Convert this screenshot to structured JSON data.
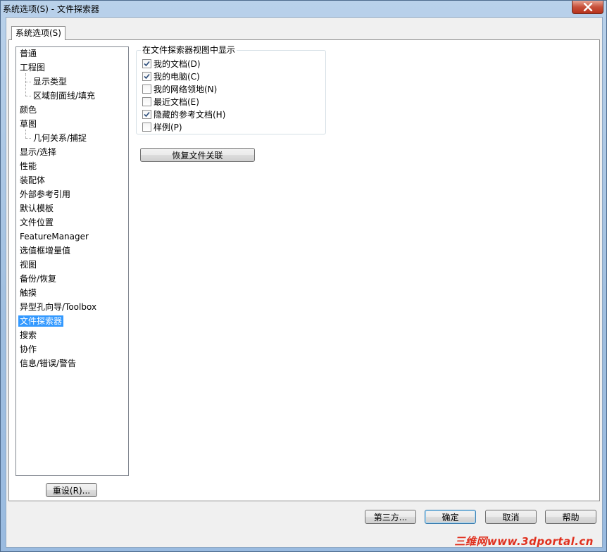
{
  "window": {
    "title": "系统选项(S) - 文件探索器"
  },
  "tab": {
    "label": "系统选项(S)"
  },
  "tree": {
    "items": [
      {
        "label": "普通",
        "level": 0
      },
      {
        "label": "工程图",
        "level": 0
      },
      {
        "label": "显示类型",
        "level": 1
      },
      {
        "label": "区域剖面线/填充",
        "level": 1
      },
      {
        "label": "颜色",
        "level": 0
      },
      {
        "label": "草图",
        "level": 0
      },
      {
        "label": "几何关系/捕捉",
        "level": 1
      },
      {
        "label": "显示/选择",
        "level": 0
      },
      {
        "label": "性能",
        "level": 0
      },
      {
        "label": "装配体",
        "level": 0
      },
      {
        "label": "外部参考引用",
        "level": 0
      },
      {
        "label": "默认模板",
        "level": 0
      },
      {
        "label": "文件位置",
        "level": 0
      },
      {
        "label": "FeatureManager",
        "level": 0
      },
      {
        "label": "选值框增量值",
        "level": 0
      },
      {
        "label": "视图",
        "level": 0
      },
      {
        "label": "备份/恢复",
        "level": 0
      },
      {
        "label": "触摸",
        "level": 0
      },
      {
        "label": "异型孔向导/Toolbox",
        "level": 0
      },
      {
        "label": "文件探索器",
        "level": 0,
        "selected": true
      },
      {
        "label": "搜索",
        "level": 0
      },
      {
        "label": "协作",
        "level": 0
      },
      {
        "label": "信息/错误/警告",
        "level": 0
      }
    ],
    "selected": "文件探索器"
  },
  "reset_button": "重设(R)...",
  "group": {
    "title": "在文件探索器视图中显示",
    "options": [
      {
        "label": "我的文档(D)",
        "checked": true
      },
      {
        "label": "我的电脑(C)",
        "checked": true
      },
      {
        "label": "我的网络领地(N)",
        "checked": false
      },
      {
        "label": "最近文档(E)",
        "checked": false
      },
      {
        "label": "隐藏的参考文档(H)",
        "checked": true
      },
      {
        "label": "样例(P)",
        "checked": false
      }
    ]
  },
  "restore_button": "恢复文件关联",
  "footer": {
    "third_party": "第三方...",
    "ok": "确定",
    "cancel": "取消",
    "help": "帮助"
  },
  "watermark": "三维网www.3dportal.cn",
  "colors": {
    "selection": "#3399ff",
    "title_bar": "#b9d1ea",
    "close_button": "#c7503a",
    "watermark": "#e0301e"
  }
}
